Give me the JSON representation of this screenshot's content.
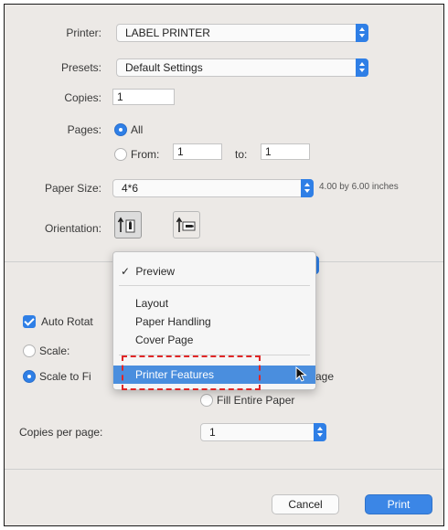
{
  "printer": {
    "label": "Printer:",
    "value": "LABEL PRINTER"
  },
  "presets": {
    "label": "Presets:",
    "value": "Default Settings"
  },
  "copies": {
    "label": "Copies:",
    "value": "1"
  },
  "pages": {
    "label": "Pages:",
    "all_label": "All",
    "from_label": "From:",
    "from_value": "1",
    "to_label": "to:",
    "to_value": "1",
    "selected": "All"
  },
  "paper_size": {
    "label": "Paper Size:",
    "value": "4*6",
    "dimensions": "4.00 by 6.00 inches"
  },
  "orientation": {
    "label": "Orientation:",
    "selected": "portrait"
  },
  "panel_menu": {
    "selected": "Preview",
    "items": [
      "Preview",
      "Layout",
      "Paper Handling",
      "Cover Page",
      "Printer Features"
    ],
    "highlighted": "Printer Features",
    "check_glyph": "✓"
  },
  "preview_options": {
    "auto_rotate_label": "Auto Rotat",
    "auto_rotate_checked": true,
    "scale_label": "Scale:",
    "scale_to_fit_label": "Scale to Fi",
    "print_entire_label": "age",
    "fill_entire_label": "Fill Entire Paper"
  },
  "copies_per_page": {
    "label": "Copies per page:",
    "value": "1"
  },
  "buttons": {
    "cancel": "Cancel",
    "print": "Print"
  },
  "colors": {
    "accent": "#2f7fe6",
    "highlight": "#4a8ede",
    "annotation": "#e02626"
  }
}
